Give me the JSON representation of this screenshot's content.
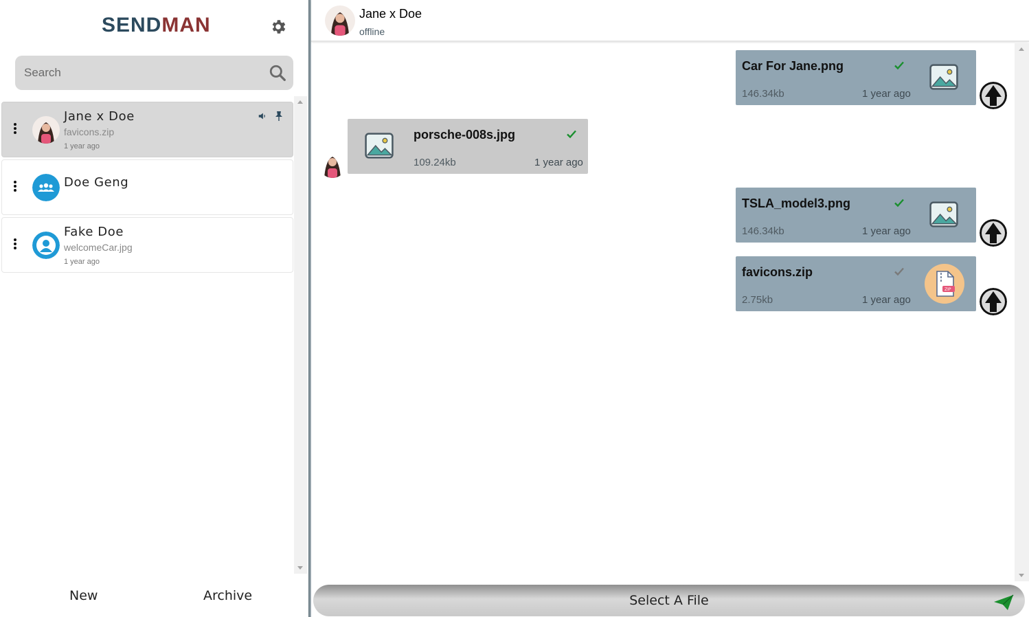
{
  "app": {
    "logo_part1": "SEND",
    "logo_part2": "MAN"
  },
  "search": {
    "placeholder": "Search"
  },
  "chats": [
    {
      "name": "Jane x Doe",
      "last_file": "favicons.zip",
      "time": "1 year ago",
      "active": true,
      "muted": true,
      "pinned": true
    },
    {
      "name": "Doe Geng",
      "last_file": "",
      "time": "",
      "type": "group"
    },
    {
      "name": "Fake Doe",
      "last_file": "welcomeCar.jpg",
      "time": "1 year ago"
    }
  ],
  "footer": {
    "new_label": "New",
    "archive_label": "Archive"
  },
  "header": {
    "name": "Jane x Doe",
    "status": "offline"
  },
  "messages": [
    {
      "direction": "out",
      "file_name": "Car For Jane.png",
      "size": "146.34kb",
      "time": "1 year ago",
      "read": true,
      "file_type": "image"
    },
    {
      "direction": "in",
      "file_name": "porsche-008s.jpg",
      "size": "109.24kb",
      "time": "1 year ago",
      "read": true,
      "file_type": "image"
    },
    {
      "direction": "out",
      "file_name": "TSLA_model3.png",
      "size": "146.34kb",
      "time": "1 year ago",
      "read": true,
      "file_type": "image"
    },
    {
      "direction": "out",
      "file_name": "favicons.zip",
      "size": "2.75kb",
      "time": "1 year ago",
      "read": false,
      "file_type": "zip"
    }
  ],
  "composer": {
    "label": "Select A File"
  },
  "colors": {
    "logo_dark": "#2c4a5e",
    "logo_red": "#8a3333",
    "outgoing_bubble": "#91a5b2",
    "incoming_bubble": "#c9c9c9",
    "check_read": "#1a8f2e",
    "check_unread": "#7a7a7a",
    "send_icon": "#1a8f2e",
    "group_avatar": "#1f9ad6"
  }
}
